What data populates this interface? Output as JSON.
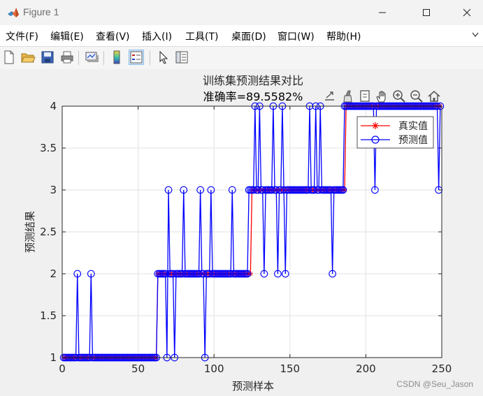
{
  "window": {
    "title": "Figure 1"
  },
  "menu": {
    "items": [
      "文件(F)",
      "编辑(E)",
      "查看(V)",
      "插入(I)",
      "工具(T)",
      "桌面(D)",
      "窗口(W)",
      "帮助(H)"
    ]
  },
  "toolbar": {
    "buttons": [
      "new-figure",
      "open-file",
      "save",
      "print",
      "link",
      "insert-colorbar",
      "insert-legend",
      "edit-plot",
      "property-inspector"
    ]
  },
  "axes_toolbar": {
    "buttons": [
      "export",
      "brush",
      "data-tips",
      "pan",
      "zoom-in",
      "zoom-out",
      "restore-view"
    ]
  },
  "watermark": "CSDN @Seu_Jason",
  "chart_data": {
    "type": "line",
    "title": "训练集预测结果对比",
    "subtitle": "准确率=89.5582%",
    "xlabel": "预测样本",
    "ylabel": "预测结果",
    "xlim": [
      0,
      250
    ],
    "ylim": [
      1,
      4
    ],
    "xticks": [
      0,
      50,
      100,
      150,
      200,
      250
    ],
    "yticks": [
      1,
      1.5,
      2,
      2.5,
      3,
      3.5,
      4
    ],
    "grid": true,
    "legend_position": "top-right",
    "series": [
      {
        "name": "真实值",
        "color": "#ff0000",
        "marker": "*",
        "runs": [
          {
            "from": 1,
            "to": 62,
            "value": 1
          },
          {
            "from": 63,
            "to": 124,
            "value": 2
          },
          {
            "from": 125,
            "to": 186,
            "value": 3
          },
          {
            "from": 187,
            "to": 249,
            "value": 4
          }
        ]
      },
      {
        "name": "预测值",
        "color": "#0000ff",
        "marker": "o",
        "base_runs": [
          {
            "from": 1,
            "to": 62,
            "value": 1
          },
          {
            "from": 63,
            "to": 122,
            "value": 2
          },
          {
            "from": 123,
            "to": 185,
            "value": 3
          },
          {
            "from": 186,
            "to": 249,
            "value": 4
          }
        ],
        "exceptions": [
          {
            "x": 10,
            "y": 2
          },
          {
            "x": 19,
            "y": 2
          },
          {
            "x": 69,
            "y": 1
          },
          {
            "x": 70,
            "y": 3
          },
          {
            "x": 74,
            "y": 1
          },
          {
            "x": 80,
            "y": 3
          },
          {
            "x": 91,
            "y": 3
          },
          {
            "x": 94,
            "y": 1
          },
          {
            "x": 98,
            "y": 3
          },
          {
            "x": 112,
            "y": 3
          },
          {
            "x": 127,
            "y": 4
          },
          {
            "x": 130,
            "y": 4
          },
          {
            "x": 133,
            "y": 2
          },
          {
            "x": 139,
            "y": 4
          },
          {
            "x": 142,
            "y": 2
          },
          {
            "x": 145,
            "y": 4
          },
          {
            "x": 147,
            "y": 2
          },
          {
            "x": 163,
            "y": 4
          },
          {
            "x": 167,
            "y": 4
          },
          {
            "x": 170,
            "y": 4
          },
          {
            "x": 178,
            "y": 2
          },
          {
            "x": 206,
            "y": 3
          },
          {
            "x": 248,
            "y": 3
          }
        ]
      }
    ]
  }
}
